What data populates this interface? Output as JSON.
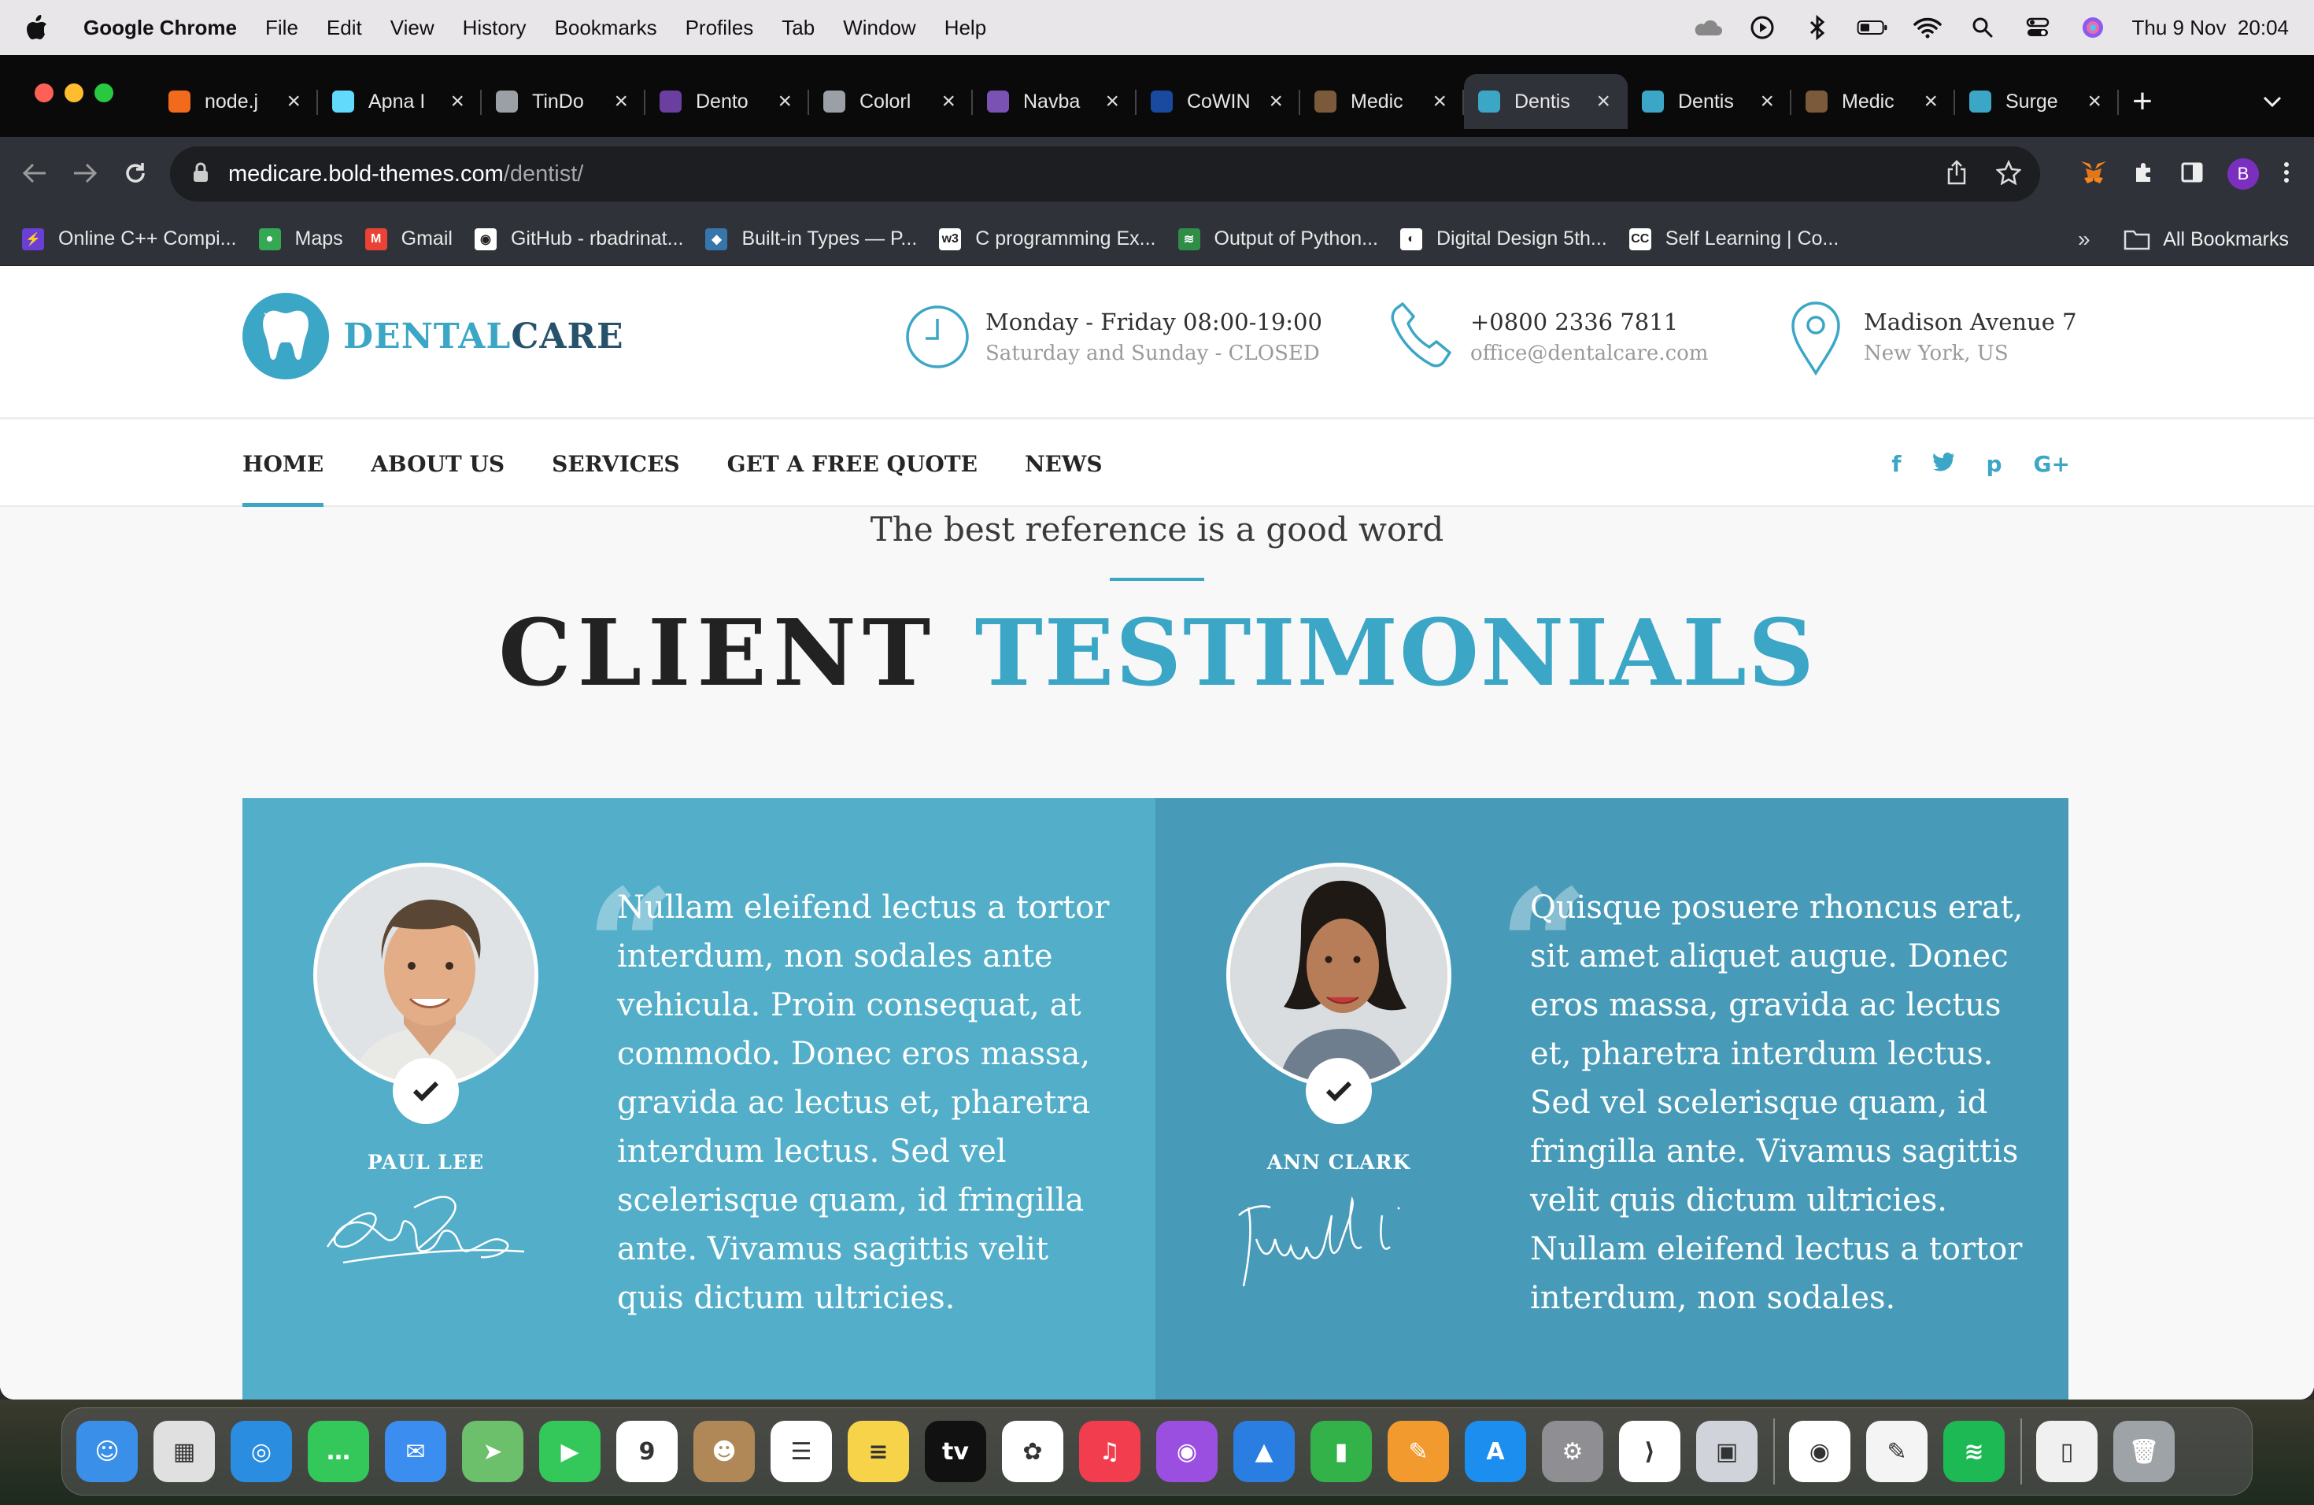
{
  "menubar": {
    "app_name": "Google Chrome",
    "items": [
      "File",
      "Edit",
      "View",
      "History",
      "Bookmarks",
      "Profiles",
      "Tab",
      "Window",
      "Help"
    ],
    "clock": "Thu 9 Nov  20:04"
  },
  "browser": {
    "tabs": [
      {
        "label": "node.j",
        "color": "#f26a1b"
      },
      {
        "label": "Apna I",
        "color": "#61dafb"
      },
      {
        "label": "TinDo",
        "color": "#9aa0a6"
      },
      {
        "label": "Dento",
        "color": "#6a3fa0"
      },
      {
        "label": "Colorl",
        "color": "#9aa0a6"
      },
      {
        "label": "Navba",
        "color": "#7952b3"
      },
      {
        "label": "CoWIN",
        "color": "#1a4aa0"
      },
      {
        "label": "Medic",
        "color": "#7a5a3a"
      },
      {
        "label": "Dentis",
        "color": "#3ba6c6",
        "active": true
      },
      {
        "label": "Dentis",
        "color": "#3ba6c6"
      },
      {
        "label": "Medic",
        "color": "#7a5a3a"
      },
      {
        "label": "Surge",
        "color": "#3ba6c6"
      }
    ],
    "url_host": "medicare.bold-themes.com",
    "url_path": "/dentist/",
    "profile_initial": "B",
    "bookmarks": [
      {
        "label": "Online C++ Compi...",
        "color": "#6b3fd6",
        "glyph": "⚡"
      },
      {
        "label": "Maps",
        "color": "#34a853",
        "glyph": "●"
      },
      {
        "label": "Gmail",
        "color": "#ea4335",
        "glyph": "M"
      },
      {
        "label": "GitHub - rbadrinat...",
        "color": "#ffffff",
        "glyph": "◉"
      },
      {
        "label": "Built-in Types — P...",
        "color": "#3776ab",
        "glyph": "◆"
      },
      {
        "label": "C programming Ex...",
        "color": "#ffffff",
        "glyph": "w3"
      },
      {
        "label": "Output of Python...",
        "color": "#2f8d46",
        "glyph": "≋"
      },
      {
        "label": "Digital Design 5th...",
        "color": "#ffffff",
        "glyph": "◐"
      },
      {
        "label": "Self Learning | Co...",
        "color": "#ffffff",
        "glyph": "CC"
      }
    ],
    "bookmarks_more": "»",
    "all_bookmarks": "All Bookmarks"
  },
  "site": {
    "logo_part1": "DENTAL",
    "logo_part2": "CARE",
    "hours_line1": "Monday - Friday 08:00-19:00",
    "hours_line2": "Saturday and Sunday - CLOSED",
    "phone_line1": "+0800 2336 7811",
    "phone_line2": "office@dentalcare.com",
    "address_line1": "Madison Avenue 7",
    "address_line2": "New York, US",
    "nav": [
      "HOME",
      "ABOUT US",
      "SERVICES",
      "GET A FREE QUOTE",
      "NEWS"
    ],
    "social": {
      "facebook": "f",
      "twitter": "t",
      "pinterest": "p",
      "googleplus": "G+"
    }
  },
  "testimonials": {
    "supertitle": "The best reference is a good word",
    "title_part1": "CLIENT",
    "title_part2": "TESTIMONIALS",
    "items": [
      {
        "name": "PAUL LEE",
        "quote": "Nullam eleifend lectus a tortor interdum, non sodales ante vehicula. Proin consequat, at commodo. Donec eros massa, gravida ac lectus et, pharetra interdum lectus. Sed vel scelerisque quam, id fringilla ante. Vivamus sagittis velit quis dictum ultricies."
      },
      {
        "name": "ANN CLARK",
        "quote": "Quisque posuere rhoncus erat, sit amet aliquet augue. Donec eros massa, gravida ac lectus et, pharetra interdum lectus. Sed vel scelerisque quam, id fringilla ante. Vivamus sagittis velit quis dictum ultricies. Nullam eleifend lectus a tortor interdum, non sodales."
      }
    ]
  },
  "dock": [
    {
      "name": "Finder",
      "color": "#3a8fe8",
      "glyph": "☺"
    },
    {
      "name": "Launchpad",
      "color": "#e0e0e0",
      "glyph": "▦"
    },
    {
      "name": "Safari",
      "color": "#2a8de0",
      "glyph": "◎"
    },
    {
      "name": "Messages",
      "color": "#34c759",
      "glyph": "…"
    },
    {
      "name": "Mail",
      "color": "#3b8ef0",
      "glyph": "✉"
    },
    {
      "name": "Maps",
      "color": "#6cc06c",
      "glyph": "➤"
    },
    {
      "name": "FaceTime",
      "color": "#34c759",
      "glyph": "▶"
    },
    {
      "name": "Calendar",
      "color": "#ffffff",
      "glyph": "9"
    },
    {
      "name": "Contacts",
      "color": "#b08858",
      "glyph": "☻"
    },
    {
      "name": "Reminders",
      "color": "#ffffff",
      "glyph": "☰"
    },
    {
      "name": "Notes",
      "color": "#f7d34a",
      "glyph": "≡"
    },
    {
      "name": "TV",
      "color": "#111111",
      "glyph": "tv"
    },
    {
      "name": "Photos",
      "color": "#ffffff",
      "glyph": "✿"
    },
    {
      "name": "Music",
      "color": "#f23d4f",
      "glyph": "♫"
    },
    {
      "name": "Podcasts",
      "color": "#9b4fe0",
      "glyph": "◉"
    },
    {
      "name": "Keynote",
      "color": "#2a7de1",
      "glyph": "▲"
    },
    {
      "name": "Numbers",
      "color": "#33b24a",
      "glyph": "▮"
    },
    {
      "name": "Pages",
      "color": "#f29a2e",
      "glyph": "✎"
    },
    {
      "name": "App Store",
      "color": "#1c8ef0",
      "glyph": "A"
    },
    {
      "name": "System Settings",
      "color": "#8e8e93",
      "glyph": "⚙"
    },
    {
      "name": "VS Code",
      "color": "#ffffff",
      "glyph": "⟩"
    },
    {
      "name": "Preview",
      "color": "#d0d4da",
      "glyph": "▣"
    },
    {
      "name": "Chrome",
      "color": "#ffffff",
      "glyph": "◉"
    },
    {
      "name": "TextEdit",
      "color": "#f4f4f4",
      "glyph": "✎"
    },
    {
      "name": "Spotify",
      "color": "#1db954",
      "glyph": "≋"
    },
    {
      "name": "Document",
      "color": "#f0f0f0",
      "glyph": "▯"
    },
    {
      "name": "Trash",
      "color": "#9ea3a8",
      "glyph": "🗑"
    }
  ]
}
